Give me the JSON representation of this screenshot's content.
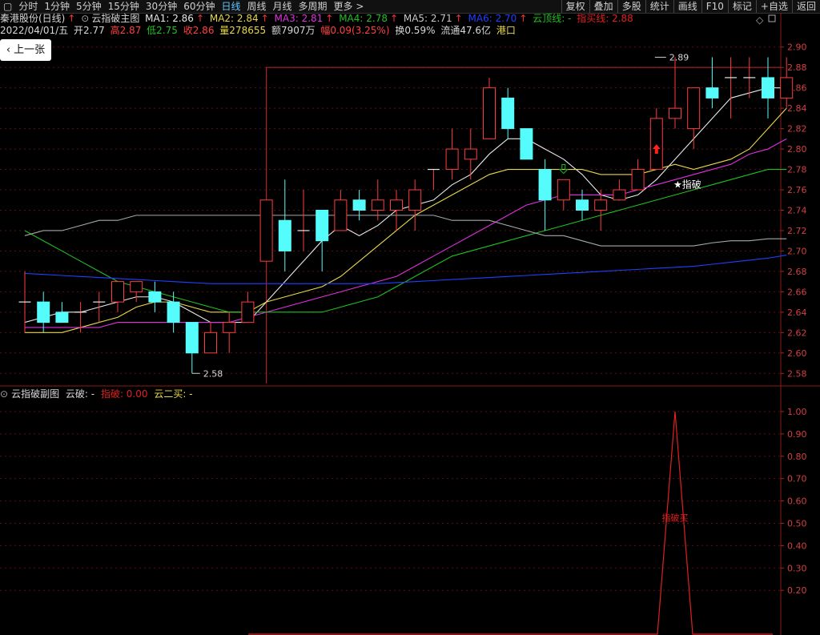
{
  "toolbar": {
    "periods": [
      "分时",
      "1分钟",
      "5分钟",
      "15分钟",
      "30分钟",
      "60分钟",
      "日线",
      "周线",
      "月线",
      "多周期",
      "更多 >"
    ],
    "active_period": "日线",
    "right_items": [
      "复权",
      "叠加",
      "多股",
      "统计",
      "画线",
      "F10",
      "标记",
      "+自选",
      "返回"
    ]
  },
  "header": {
    "stock": "秦港股份(日线)",
    "indicator": "云指破主图",
    "ma1": "MA1: 2.86",
    "ma2": "MA2: 2.84",
    "ma3": "MA3: 2.81",
    "ma4": "MA4: 2.78",
    "ma5": "MA5: 2.71",
    "ma6": "MA6: 2.70",
    "yunding": "云顶线: -",
    "zhimai": "指买线: 2.88"
  },
  "quote": {
    "date": "2022/04/01/五",
    "open": "开2.77",
    "high": "高2.87",
    "low": "低2.75",
    "close": "收2.86",
    "volume": "量278655",
    "amount": "额7907万",
    "change": "幅0.09(3.25%)",
    "turnover": "换0.59%",
    "float": "流通47.6亿",
    "board": "港口"
  },
  "prev_button": "上一张",
  "sub_panel": {
    "name": "云指破副图",
    "yunpo": "云破: -",
    "zhipo": "指破: 0.00",
    "yuner": "云二买: -"
  },
  "colors": {
    "up": "#ff3c3c",
    "down": "#54fcfc",
    "ma1": "#e8e8e8",
    "ma2": "#e8d84a",
    "ma3": "#e030e0",
    "ma4": "#20c020",
    "ma5": "#a8a8a8",
    "ma6": "#2040ff",
    "frame": "#b02020"
  },
  "chart_data": [
    {
      "type": "candlestick",
      "title": "云指破主图",
      "ylim": [
        2.57,
        2.91
      ],
      "y_ticks": [
        2.58,
        2.6,
        2.62,
        2.64,
        2.66,
        2.68,
        2.7,
        2.72,
        2.74,
        2.76,
        2.78,
        2.8,
        2.82,
        2.84,
        2.86,
        2.88,
        2.9
      ],
      "candles": [
        {
          "o": 2.65,
          "h": 2.68,
          "l": 2.62,
          "c": 2.65
        },
        {
          "o": 2.65,
          "h": 2.66,
          "l": 2.62,
          "c": 2.63
        },
        {
          "o": 2.64,
          "h": 2.65,
          "l": 2.63,
          "c": 2.63
        },
        {
          "o": 2.64,
          "h": 2.65,
          "l": 2.62,
          "c": 2.64
        },
        {
          "o": 2.65,
          "h": 2.66,
          "l": 2.63,
          "c": 2.65
        },
        {
          "o": 2.65,
          "h": 2.67,
          "l": 2.64,
          "c": 2.67
        },
        {
          "o": 2.66,
          "h": 2.67,
          "l": 2.65,
          "c": 2.67
        },
        {
          "o": 2.66,
          "h": 2.67,
          "l": 2.64,
          "c": 2.65
        },
        {
          "o": 2.65,
          "h": 2.66,
          "l": 2.62,
          "c": 2.63
        },
        {
          "o": 2.63,
          "h": 2.63,
          "l": 2.58,
          "c": 2.6
        },
        {
          "o": 2.6,
          "h": 2.63,
          "l": 2.6,
          "c": 2.62
        },
        {
          "o": 2.62,
          "h": 2.64,
          "l": 2.6,
          "c": 2.63
        },
        {
          "o": 2.63,
          "h": 2.66,
          "l": 2.63,
          "c": 2.65
        },
        {
          "o": 2.69,
          "h": 2.75,
          "l": 2.69,
          "c": 2.75
        },
        {
          "o": 2.73,
          "h": 2.77,
          "l": 2.68,
          "c": 2.7
        },
        {
          "o": 2.72,
          "h": 2.76,
          "l": 2.7,
          "c": 2.72
        },
        {
          "o": 2.74,
          "h": 2.74,
          "l": 2.68,
          "c": 2.71
        },
        {
          "o": 2.72,
          "h": 2.76,
          "l": 2.72,
          "c": 2.75
        },
        {
          "o": 2.75,
          "h": 2.76,
          "l": 2.73,
          "c": 2.74
        },
        {
          "o": 2.74,
          "h": 2.77,
          "l": 2.73,
          "c": 2.75
        },
        {
          "o": 2.74,
          "h": 2.76,
          "l": 2.72,
          "c": 2.75
        },
        {
          "o": 2.74,
          "h": 2.77,
          "l": 2.72,
          "c": 2.76
        },
        {
          "o": 2.78,
          "h": 2.78,
          "l": 2.76,
          "c": 2.78
        },
        {
          "o": 2.78,
          "h": 2.82,
          "l": 2.77,
          "c": 2.8
        },
        {
          "o": 2.79,
          "h": 2.82,
          "l": 2.77,
          "c": 2.8
        },
        {
          "o": 2.81,
          "h": 2.87,
          "l": 2.81,
          "c": 2.86
        },
        {
          "o": 2.85,
          "h": 2.86,
          "l": 2.81,
          "c": 2.82
        },
        {
          "o": 2.82,
          "h": 2.82,
          "l": 2.79,
          "c": 2.79
        },
        {
          "o": 2.78,
          "h": 2.79,
          "l": 2.72,
          "c": 2.75
        },
        {
          "o": 2.75,
          "h": 2.77,
          "l": 2.74,
          "c": 2.77
        },
        {
          "o": 2.75,
          "h": 2.76,
          "l": 2.73,
          "c": 2.74
        },
        {
          "o": 2.74,
          "h": 2.76,
          "l": 2.72,
          "c": 2.75
        },
        {
          "o": 2.75,
          "h": 2.77,
          "l": 2.75,
          "c": 2.76
        },
        {
          "o": 2.76,
          "h": 2.79,
          "l": 2.76,
          "c": 2.78
        },
        {
          "o": 2.78,
          "h": 2.84,
          "l": 2.78,
          "c": 2.83
        },
        {
          "o": 2.83,
          "h": 2.89,
          "l": 2.82,
          "c": 2.84
        },
        {
          "o": 2.82,
          "h": 2.86,
          "l": 2.8,
          "c": 2.86
        },
        {
          "o": 2.86,
          "h": 2.89,
          "l": 2.84,
          "c": 2.85
        },
        {
          "o": 2.87,
          "h": 2.89,
          "l": 2.83,
          "c": 2.87
        },
        {
          "o": 2.87,
          "h": 2.89,
          "l": 2.85,
          "c": 2.87
        },
        {
          "o": 2.87,
          "h": 2.89,
          "l": 2.83,
          "c": 2.85
        },
        {
          "o": 2.85,
          "h": 2.89,
          "l": 2.84,
          "c": 2.87
        }
      ],
      "lines": [
        {
          "name": "MA1",
          "color": "#e8e8e8",
          "values": [
            2.63,
            2.635,
            2.64,
            2.64,
            2.645,
            2.65,
            2.655,
            2.655,
            2.65,
            2.64,
            2.63,
            2.63,
            2.63,
            2.65,
            2.67,
            2.69,
            2.71,
            2.725,
            2.715,
            2.725,
            2.74,
            2.745,
            2.75,
            2.765,
            2.775,
            2.795,
            2.81,
            2.81,
            2.8,
            2.79,
            2.775,
            2.755,
            2.75,
            2.755,
            2.77,
            2.79,
            2.81,
            2.83,
            2.85,
            2.855,
            2.86,
            2.86
          ]
        },
        {
          "name": "MA2",
          "color": "#e8d84a",
          "values": [
            2.62,
            2.62,
            2.62,
            2.625,
            2.63,
            2.635,
            2.645,
            2.65,
            2.65,
            2.645,
            2.64,
            2.64,
            2.64,
            2.65,
            2.655,
            2.66,
            2.665,
            2.675,
            2.69,
            2.705,
            2.72,
            2.735,
            2.745,
            2.755,
            2.765,
            2.775,
            2.78,
            2.78,
            2.78,
            2.78,
            2.78,
            2.775,
            2.775,
            2.775,
            2.78,
            2.785,
            2.78,
            2.785,
            2.79,
            2.8,
            2.82,
            2.84
          ]
        },
        {
          "name": "MA3",
          "color": "#e030e0",
          "values": [
            2.625,
            2.625,
            2.625,
            2.625,
            2.625,
            2.63,
            2.63,
            2.63,
            2.63,
            2.63,
            2.63,
            2.63,
            2.635,
            2.64,
            2.645,
            2.65,
            2.655,
            2.66,
            2.665,
            2.67,
            2.675,
            2.685,
            2.695,
            2.705,
            2.715,
            2.725,
            2.735,
            2.745,
            2.75,
            2.755,
            2.755,
            2.755,
            2.755,
            2.76,
            2.765,
            2.77,
            2.775,
            2.78,
            2.785,
            2.795,
            2.8,
            2.81
          ]
        },
        {
          "name": "MA4",
          "color": "#20c020",
          "values": [
            2.72,
            2.71,
            2.7,
            2.69,
            2.68,
            2.67,
            2.665,
            2.66,
            2.655,
            2.65,
            2.645,
            2.64,
            2.64,
            2.64,
            2.64,
            2.64,
            2.64,
            2.645,
            2.65,
            2.655,
            2.665,
            2.675,
            2.685,
            2.695,
            2.7,
            2.705,
            2.71,
            2.715,
            2.72,
            2.725,
            2.73,
            2.735,
            2.74,
            2.745,
            2.75,
            2.755,
            2.76,
            2.765,
            2.77,
            2.775,
            2.78,
            2.78
          ]
        },
        {
          "name": "MA5",
          "color": "#a8a8a8",
          "values": [
            2.715,
            2.72,
            2.72,
            2.725,
            2.73,
            2.73,
            2.735,
            2.735,
            2.735,
            2.735,
            2.735,
            2.735,
            2.735,
            2.735,
            2.735,
            2.735,
            2.735,
            2.735,
            2.735,
            2.735,
            2.735,
            2.735,
            2.735,
            2.73,
            2.73,
            2.73,
            2.725,
            2.72,
            2.715,
            2.715,
            2.71,
            2.705,
            2.705,
            2.705,
            2.705,
            2.705,
            2.705,
            2.708,
            2.71,
            2.71,
            2.712,
            2.712
          ]
        },
        {
          "name": "MA6",
          "color": "#2040ff",
          "values": [
            2.678,
            2.677,
            2.676,
            2.675,
            2.674,
            2.673,
            2.672,
            2.671,
            2.67,
            2.669,
            2.668,
            2.668,
            2.668,
            2.668,
            2.668,
            2.668,
            2.668,
            2.668,
            2.668,
            2.668,
            2.669,
            2.67,
            2.671,
            2.672,
            2.673,
            2.674,
            2.675,
            2.676,
            2.677,
            2.678,
            2.679,
            2.68,
            2.681,
            2.682,
            2.683,
            2.684,
            2.685,
            2.687,
            2.689,
            2.691,
            2.693,
            2.696
          ]
        }
      ],
      "annotations": [
        {
          "text": "2.89",
          "y": 2.89,
          "type": "high"
        },
        {
          "text": "2.58",
          "y": 2.58,
          "type": "low"
        },
        {
          "text": "★指破",
          "y": 2.765,
          "type": "label"
        }
      ]
    },
    {
      "type": "line",
      "title": "云指破副图",
      "ylim": [
        0,
        1.05
      ],
      "y_ticks": [
        0.2,
        0.3,
        0.4,
        0.5,
        0.6,
        0.7,
        0.8,
        0.9,
        1.0
      ],
      "series": [
        {
          "name": "指破",
          "color": "#e02020",
          "spike_index": 35,
          "spike_value": 1.0
        }
      ],
      "annotation": "指破买"
    }
  ]
}
